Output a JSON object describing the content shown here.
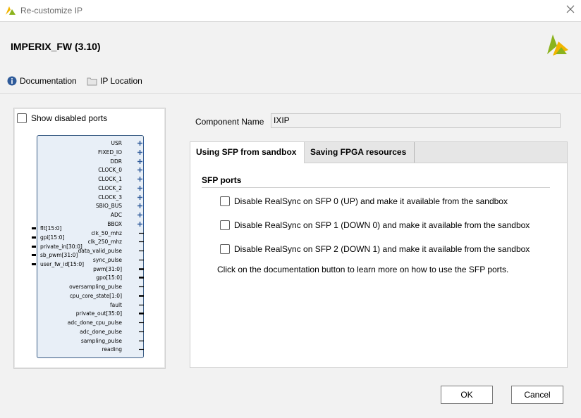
{
  "window": {
    "title": "Re-customize IP",
    "close_icon": "close-icon"
  },
  "header": {
    "ip_title": "IMPERIX_FW (3.10)",
    "logo_icon": "vivado-logo-icon"
  },
  "links": {
    "documentation": "Documentation",
    "ip_location": "IP Location",
    "documentation_icon": "info-icon",
    "ip_location_icon": "folder-icon"
  },
  "left_panel": {
    "show_disabled_ports": "Show disabled ports",
    "right_ports": [
      "USR",
      "FIXED_IO",
      "DDR",
      "CLOCK_0",
      "CLOCK_1",
      "CLOCK_2",
      "CLOCK_3",
      "SBIO_BUS",
      "ADC",
      "BBOX",
      "clk_50_mhz",
      "clk_250_mhz",
      "data_valid_pulse",
      "sync_pulse",
      "pwm[31:0]",
      "gpo[15:0]",
      "oversampling_pulse",
      "cpu_core_state[1:0]",
      "fault",
      "private_out[35:0]",
      "adc_done_cpu_pulse",
      "adc_done_pulse",
      "sampling_pulse",
      "reading"
    ],
    "left_ports": [
      "flt[15:0]",
      "gpi[15:0]",
      "private_in[30:0]",
      "sb_pwm[31:0]",
      "user_fw_id[15:0]"
    ]
  },
  "component": {
    "label": "Component Name",
    "value": "IXIP"
  },
  "tabs": [
    {
      "label": "Using SFP from sandbox"
    },
    {
      "label": "Saving FPGA resources"
    }
  ],
  "sfp": {
    "group_title": "SFP ports",
    "options": [
      {
        "label": "Disable RealSync on SFP 0 (UP) and make it available from the sandbox",
        "checked": false
      },
      {
        "label": "Disable RealSync on SFP 1 (DOWN 0) and make it available from the sandbox",
        "checked": false
      },
      {
        "label": "Disable RealSync on SFP 2 (DOWN 1) and make it available from the sandbox",
        "checked": false
      }
    ],
    "note": "Click on the documentation button to learn more on how to use the SFP ports."
  },
  "buttons": {
    "ok": "OK",
    "cancel": "Cancel"
  },
  "colors": {
    "accent_yellow": "#f2b500",
    "logo_green": "#8bb31d",
    "block_fill": "#e8eff7",
    "block_border": "#3b5d85"
  }
}
